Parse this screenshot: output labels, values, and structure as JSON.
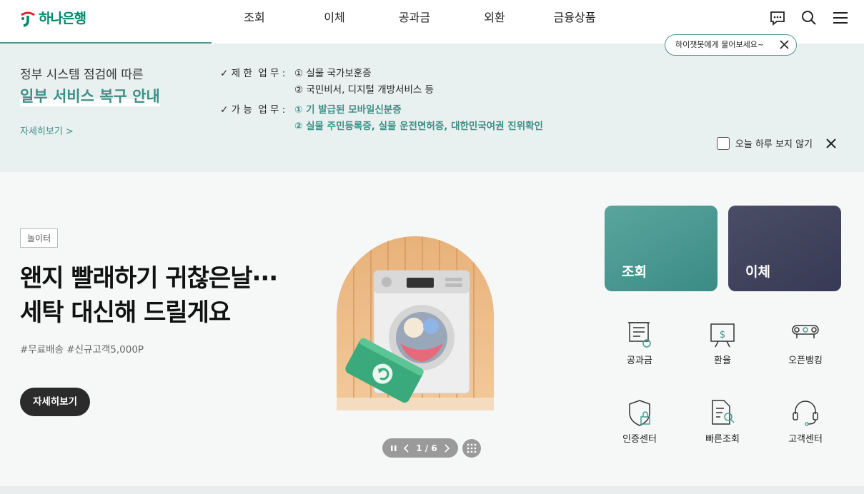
{
  "header": {
    "logo_text": "하나은행",
    "nav": [
      "조회",
      "이체",
      "공과금",
      "외환",
      "금융상품"
    ],
    "icons": [
      "chatbot-icon",
      "search-icon",
      "menu-icon"
    ],
    "tooltip": "하이챗봇에게 물어보세요~"
  },
  "notice": {
    "subtitle": "정부 시스템 점검에 따른",
    "title": "일부 서비스 복구 안내",
    "more": "자세히보기 >",
    "restricted_label": "✓ 제 한  업 무 :",
    "restricted_items": [
      "① 실물 국가보훈증",
      "② 국민비서, 디지털 개방서비스 등"
    ],
    "available_label": "✓ 가 능  업 무 :",
    "available_items": [
      "① 기 발급된 모바일신분증",
      "② 실물 주민등록증, 실물 운전면허증, 대한민국여권 진위확인"
    ],
    "hide_today": "오늘 하루 보지 않기"
  },
  "banner": {
    "badge": "놀이터",
    "headline_line1": "왠지 빨래하기 귀찮은날···",
    "headline_line2": "세탁 대신해 드릴게요",
    "tags": "#무료배송 #신규고객5,000P",
    "button": "자세히보기",
    "pager": "1 / 6"
  },
  "quick": {
    "cards": [
      "조회",
      "이체"
    ],
    "menu": [
      "공과금",
      "환율",
      "오픈뱅킹",
      "인증센터",
      "빠른조회",
      "고객센터"
    ]
  },
  "colors": {
    "brand_green": "#00876c",
    "teal": "#3d8f86",
    "navy": "#3a3d57",
    "notice_bg": "#e8f1f0"
  }
}
